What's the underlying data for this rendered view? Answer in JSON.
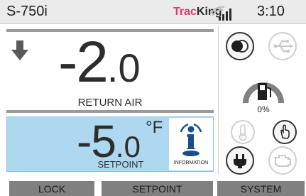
{
  "status": {
    "model": "S-750i",
    "brand_prefix": "Trac",
    "brand_suffix": "King",
    "time": "3:10"
  },
  "return_air": {
    "whole": "-2",
    "decimal": ".0",
    "label": "RETURN AIR"
  },
  "setpoint": {
    "whole": "-5",
    "decimal": ".0",
    "unit": "°F",
    "label": "SETPOINT"
  },
  "info": {
    "label": "INFORMATION"
  },
  "fuel": {
    "percent": "0%"
  },
  "buttons": {
    "lock": "LOCK",
    "setpoint": "SETPOINT",
    "system": "SYSTEM"
  },
  "colors": {
    "setpoint_bg": "#add8f0",
    "info_blue": "#1a4f8c",
    "brand": "#e03a6a"
  }
}
